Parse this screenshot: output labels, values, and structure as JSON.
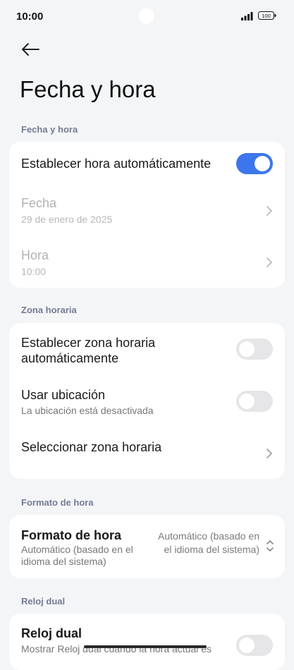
{
  "status_bar": {
    "time": "10:00",
    "battery": "100",
    "icons": [
      "signal-icon",
      "battery-icon"
    ]
  },
  "header": {
    "back_icon": "arrow-left-icon",
    "title": "Fecha y hora"
  },
  "sections": {
    "date_time": {
      "label": "Fecha y hora",
      "auto_time": {
        "title": "Establecer hora automáticamente",
        "enabled": true
      },
      "date": {
        "title": "Fecha",
        "value": "29 de enero de 2025"
      },
      "time": {
        "title": "Hora",
        "value": "10:00"
      }
    },
    "time_zone": {
      "label": "Zona horaria",
      "auto_zone": {
        "title": "Establecer zona horaria automáticamente",
        "enabled": false
      },
      "use_location": {
        "title": "Usar ubicación",
        "subtitle": "La ubicación está desactivada",
        "enabled": false
      },
      "select_zone": {
        "title": "Seleccionar zona horaria"
      }
    },
    "time_format": {
      "label": "Formato de hora",
      "format": {
        "title": "Formato de hora",
        "subtitle": "Automático (basado en el idioma del sistema)",
        "value": "Automático (basado en el idioma del sistema)"
      }
    },
    "dual_clock": {
      "label": "Reloj dual",
      "dual": {
        "title": "Reloj dual",
        "subtitle": "Mostrar Reloj dual cuando la hora actual es",
        "enabled": false
      }
    }
  },
  "colors": {
    "accent": "#3c76ec",
    "background": "#f4f5f7",
    "card": "#ffffff",
    "section_label": "#747c93"
  }
}
